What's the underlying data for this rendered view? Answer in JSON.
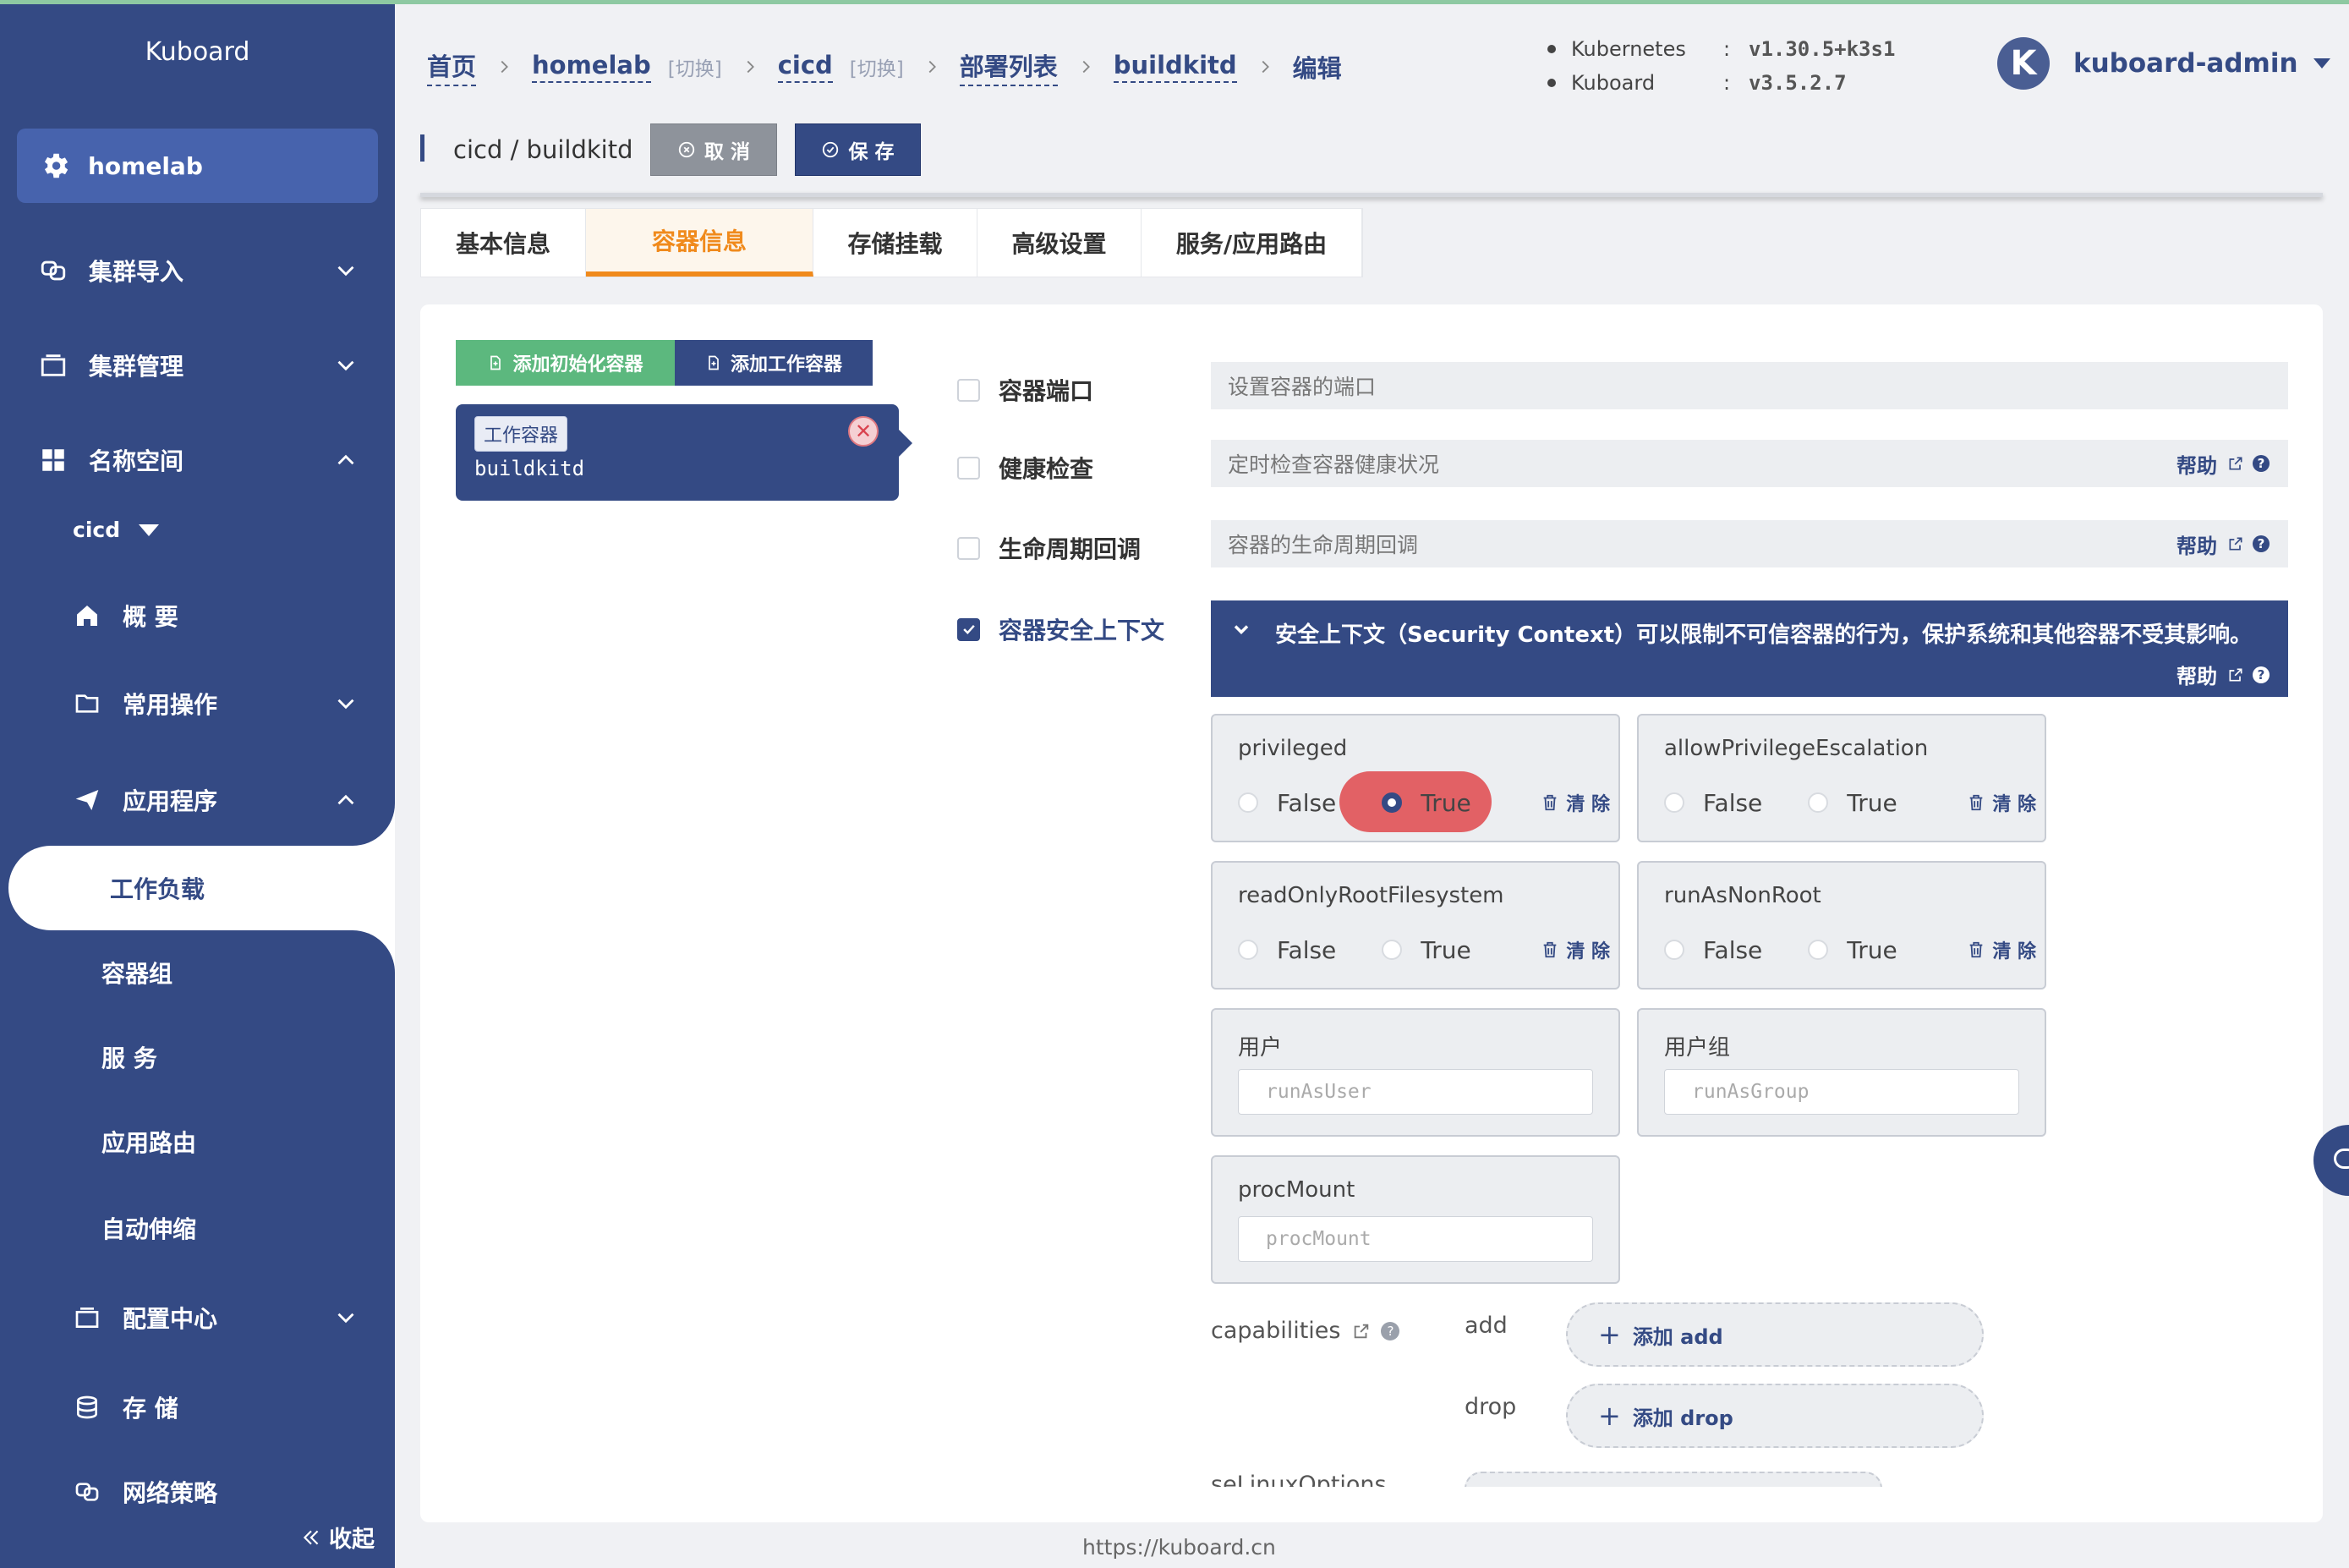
{
  "sidebar": {
    "brand": "Kuboard",
    "cluster": "homelab",
    "items": [
      {
        "label": "集群导入"
      },
      {
        "label": "集群管理"
      },
      {
        "label": "名称空间"
      }
    ],
    "namespace": "cicd",
    "ns_items": [
      {
        "label": "概 要"
      },
      {
        "label": "常用操作"
      },
      {
        "label": "应用程序"
      }
    ],
    "app_items": [
      {
        "label": "工作负载"
      },
      {
        "label": "容器组"
      },
      {
        "label": "服 务"
      },
      {
        "label": "应用路由"
      },
      {
        "label": "自动伸缩"
      }
    ],
    "bottom_items": [
      {
        "label": "配置中心"
      },
      {
        "label": "存 储"
      },
      {
        "label": "网络策略"
      }
    ],
    "collapse": "收起"
  },
  "breadcrumb": {
    "home": "首页",
    "cluster": "homelab",
    "cluster_switch": "[切换]",
    "namespace": "cicd",
    "namespace_switch": "[切换]",
    "list": "部署列表",
    "workload": "buildkitd",
    "current": "编辑"
  },
  "versions": {
    "k8s_label": "Kubernetes",
    "k8s_value": "v1.30.5+k3s1",
    "kuboard_label": "Kuboard",
    "kuboard_value": "v3.5.2.7",
    "colon": ":"
  },
  "user": {
    "avatar": "K",
    "name": "kuboard-admin"
  },
  "header": {
    "title": "cicd / buildkitd",
    "cancel": "取 消",
    "save": "保 存"
  },
  "tabs": [
    {
      "label": "基本信息"
    },
    {
      "label": "容器信息"
    },
    {
      "label": "存储挂载"
    },
    {
      "label": "高级设置"
    },
    {
      "label": "服务/应用路由"
    }
  ],
  "containers": {
    "add_init": "添加初始化容器",
    "add_work": "添加工作容器",
    "card_tag": "工作容器",
    "card_name": "buildkitd"
  },
  "features": {
    "ports_label": "容器端口",
    "ports_placeholder": "设置容器的端口",
    "health_label": "健康检查",
    "health_placeholder": "定时检查容器健康状况",
    "lifecycle_label": "生命周期回调",
    "lifecycle_placeholder": "容器的生命周期回调",
    "security_label": "容器安全上下文",
    "help": "帮助"
  },
  "security": {
    "description": "安全上下文（Security Context）可以限制不可信容器的行为，保护系统和其他容器不受其影响。",
    "false_label": "False",
    "true_label": "True",
    "clear": "清 除",
    "privileged": "privileged",
    "allow_priv_esc": "allowPrivilegeEscalation",
    "read_only_root": "readOnlyRootFilesystem",
    "run_as_non_root": "runAsNonRoot",
    "user_label": "用户",
    "user_placeholder": "runAsUser",
    "group_label": "用户组",
    "group_placeholder": "runAsGroup",
    "proc_label": "procMount",
    "proc_placeholder": "procMount",
    "capabilities": "capabilities",
    "add_key": "add",
    "add_btn": "添加 add",
    "drop_key": "drop",
    "drop_btn": "添加 drop",
    "selinux": "seLinuxOptions"
  },
  "footer": {
    "url": "https://kuboard.cn"
  },
  "colors": {
    "sidebar": "#344a84",
    "accent_orange": "#f08a1c",
    "green": "#5cb87e",
    "highlight": "#e0484c"
  }
}
